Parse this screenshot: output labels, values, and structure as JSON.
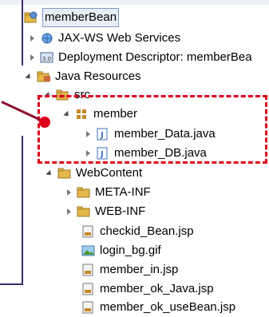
{
  "tree": {
    "project": "memberBean",
    "items": [
      {
        "label": "JAX-WS Web Services"
      },
      {
        "label": "Deployment Descriptor: memberBea"
      },
      {
        "label": "Java Resources"
      },
      {
        "label": "src"
      },
      {
        "label": "member"
      },
      {
        "label": "member_Data.java"
      },
      {
        "label": "member_DB.java"
      },
      {
        "label": "WebContent"
      },
      {
        "label": "META-INF"
      },
      {
        "label": "WEB-INF"
      },
      {
        "label": "checkid_Bean.jsp"
      },
      {
        "label": "login_bg.gif"
      },
      {
        "label": "member_in.jsp"
      },
      {
        "label": "member_ok_Java.jsp"
      },
      {
        "label": "member_ok_useBean.jsp"
      }
    ]
  },
  "colors": {
    "highlight": "#e0001b",
    "frame": "#3d2a6b",
    "folder": "#e6b84a",
    "java": "#3b6fc4"
  },
  "icons": {
    "project": "web-project-icon",
    "jaxws": "web-services-icon",
    "descriptor": "deployment-descriptor-icon",
    "java_resources": "java-resources-icon",
    "src": "source-folder-icon",
    "package": "package-icon",
    "java_file": "java-file-icon",
    "folder": "folder-icon",
    "jsp_file": "jsp-file-icon",
    "gif_file": "image-file-icon"
  }
}
